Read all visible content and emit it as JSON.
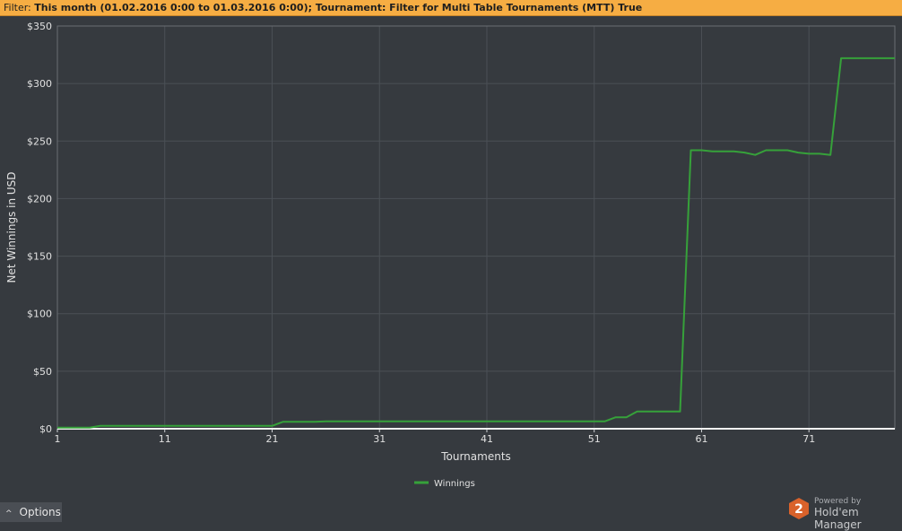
{
  "filter": {
    "label": "Filter:",
    "text": "This month (01.02.2016 0:00 to 01.03.2016 0:00); Tournament: Filter for Multi Table Tournaments (MTT) True"
  },
  "options": {
    "label": "Options",
    "icon": "chevron-up-icon"
  },
  "brand": {
    "powered": "Powered by",
    "name": "Hold'em Manager",
    "logo_text": "2",
    "logo_color": "#d9622b"
  },
  "colors": {
    "background": "#363a3f",
    "grid": "#4b5056",
    "line": "#36a13a",
    "axis_text": "#e0e0e0",
    "filter_bar": "#f6ad43"
  },
  "chart_data": {
    "type": "line",
    "xlabel": "Tournaments",
    "ylabel": "Net Winnings in USD",
    "xlim": [
      1,
      79
    ],
    "ylim": [
      0,
      350
    ],
    "x_ticks": [
      1,
      11,
      21,
      31,
      41,
      51,
      61,
      71
    ],
    "y_ticks": [
      0,
      50,
      100,
      150,
      200,
      250,
      300,
      350
    ],
    "y_tick_labels": [
      "$0",
      "$50",
      "$100",
      "$150",
      "$200",
      "$250",
      "$300",
      "$350"
    ],
    "grid": true,
    "legend_position": "bottom",
    "series": [
      {
        "name": "Winnings",
        "color": "#36a13a",
        "x": [
          1,
          2,
          3,
          4,
          5,
          6,
          7,
          8,
          9,
          10,
          11,
          12,
          13,
          14,
          15,
          16,
          17,
          18,
          19,
          20,
          21,
          22,
          23,
          24,
          25,
          26,
          27,
          28,
          29,
          30,
          31,
          32,
          33,
          34,
          35,
          36,
          37,
          38,
          39,
          40,
          41,
          42,
          43,
          44,
          45,
          46,
          47,
          48,
          49,
          50,
          51,
          52,
          53,
          54,
          55,
          56,
          57,
          58,
          59,
          60,
          61,
          62,
          63,
          64,
          65,
          66,
          67,
          68,
          69,
          70,
          71,
          72,
          73,
          74,
          75,
          76,
          77,
          78,
          79
        ],
        "values": [
          1,
          1,
          1,
          1,
          2.5,
          2.5,
          2.5,
          2.5,
          2.5,
          2.5,
          2.5,
          2.5,
          2.5,
          2.5,
          2.5,
          2.5,
          2.5,
          2.5,
          2.5,
          2.5,
          2.5,
          6,
          6,
          6,
          6,
          6.5,
          6.5,
          6.5,
          6.5,
          6.5,
          6.5,
          6.5,
          6.5,
          6.5,
          6.5,
          6.5,
          6.5,
          6.5,
          6.5,
          6.5,
          6.5,
          6.5,
          6.5,
          6.5,
          6.5,
          6.5,
          6.5,
          6.5,
          6.5,
          6.5,
          6.5,
          6.5,
          10,
          10,
          15,
          15,
          15,
          15,
          15,
          242,
          242,
          241,
          241,
          241,
          240,
          238,
          242,
          242,
          242,
          240,
          239,
          239,
          238,
          322,
          322,
          322,
          322,
          322,
          322
        ]
      }
    ]
  }
}
